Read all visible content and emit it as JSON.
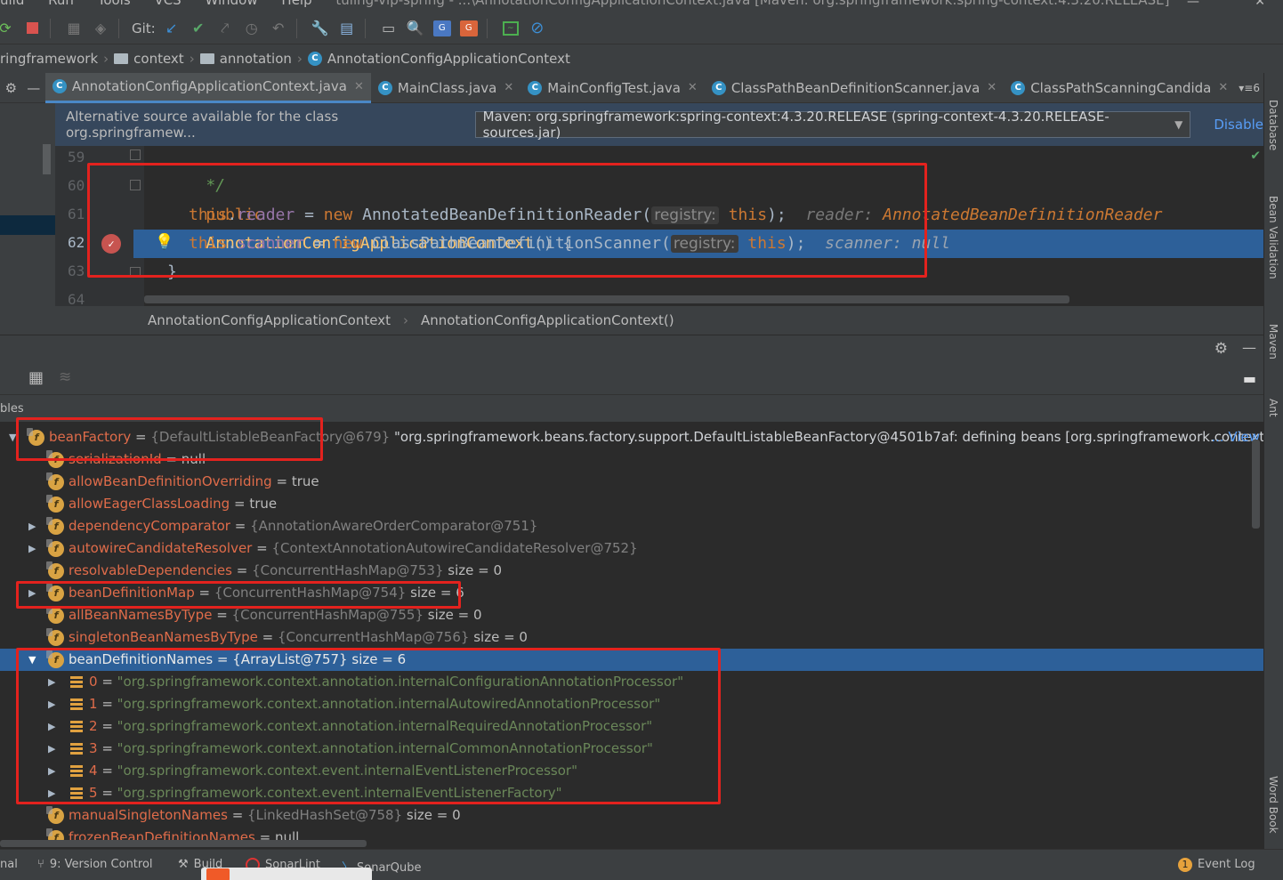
{
  "menu": {
    "items": [
      "uild",
      "Run",
      "Tools",
      "VCS",
      "Window",
      "Help"
    ],
    "window_title": "tuling-vip-spring - ...\\AnnotationConfigApplicationContext.java [Maven: org.springframework:spring-context:4.3.20.RELEASE]"
  },
  "toolbar": {
    "git_label": "Git:"
  },
  "breadcrumb": {
    "items": [
      "ringframework",
      "context",
      "annotation",
      "AnnotationConfigApplicationContext"
    ]
  },
  "tabs": [
    {
      "label": "AnnotationConfigApplicationContext.java",
      "active": true
    },
    {
      "label": "MainClass.java",
      "active": false
    },
    {
      "label": "MainConfigTest.java",
      "active": false
    },
    {
      "label": "ClassPathBeanDefinitionScanner.java",
      "active": false
    },
    {
      "label": "ClassPathScanningCandida",
      "active": false
    }
  ],
  "tabs_overflow": "▾≡6",
  "banner": {
    "message": "Alternative source available for the class org.springframew...",
    "selected_source": "Maven: org.springframework:spring-context:4.3.20.RELEASE (spring-context-4.3.20.RELEASE-sources.jar)",
    "disable_label": "Disable"
  },
  "editor": {
    "line_numbers": [
      "59",
      "60",
      "61",
      "62",
      "63",
      "64"
    ],
    "comment": "*/",
    "line60": {
      "kw": "public",
      "method": "AnnotationConfigApplicationContext",
      "rest": "() {"
    },
    "line61": {
      "this": "this",
      "field": "reader",
      "eq": " = ",
      "new": "new",
      "type": " AnnotatedBeanDefinitionReader(",
      "hint": "registry:",
      "arg": "this",
      "end": ");",
      "inline_name": "reader:",
      "inline_value": "AnnotatedBeanDefinitionReader"
    },
    "line62": {
      "this": "this",
      "field": "scanner",
      "eq": " = ",
      "new": "new",
      "type": " ClassPathBeanDefinitionScanner(",
      "hint": "registry:",
      "arg": "this",
      "end": ");",
      "inline_name": "scanner:",
      "inline_value": "null"
    },
    "line63": "}"
  },
  "structure_crumbs": [
    "AnnotationConfigApplicationContext",
    "AnnotationConfigApplicationContext()"
  ],
  "variables_header": "bles",
  "variables": [
    {
      "name": "beanFactory",
      "type": "{DefaultListableBeanFactory@679}",
      "value": "\"org.springframework.beans.factory.support.DefaultListableBeanFactory@4501b7af: defining beans [org.springframework.context",
      "view": "... View"
    },
    {
      "name": "serializationId",
      "value": "null"
    },
    {
      "name": "allowBeanDefinitionOverriding",
      "value": "true"
    },
    {
      "name": "allowEagerClassLoading",
      "value": "true"
    },
    {
      "name": "dependencyComparator",
      "type": "{AnnotationAwareOrderComparator@751}"
    },
    {
      "name": "autowireCandidateResolver",
      "type": "{ContextAnnotationAutowireCandidateResolver@752}"
    },
    {
      "name": "resolvableDependencies",
      "type": "{ConcurrentHashMap@753}",
      "value": "size = 0"
    },
    {
      "name": "beanDefinitionMap",
      "type": "{ConcurrentHashMap@754}",
      "value": "size = 6"
    },
    {
      "name": "allBeanNamesByType",
      "type": "{ConcurrentHashMap@755}",
      "value": "size = 0"
    },
    {
      "name": "singletonBeanNamesByType",
      "type": "{ConcurrentHashMap@756}",
      "value": "size = 0"
    },
    {
      "name": "beanDefinitionNames",
      "type": "{ArrayList@757}",
      "value": "size = 6"
    },
    {
      "index": "0",
      "value": "\"org.springframework.context.annotation.internalConfigurationAnnotationProcessor\""
    },
    {
      "index": "1",
      "value": "\"org.springframework.context.annotation.internalAutowiredAnnotationProcessor\""
    },
    {
      "index": "2",
      "value": "\"org.springframework.context.annotation.internalRequiredAnnotationProcessor\""
    },
    {
      "index": "3",
      "value": "\"org.springframework.context.annotation.internalCommonAnnotationProcessor\""
    },
    {
      "index": "4",
      "value": "\"org.springframework.context.event.internalEventListenerProcessor\""
    },
    {
      "index": "5",
      "value": "\"org.springframework.context.event.internalEventListenerFactory\""
    },
    {
      "name": "manualSingletonNames",
      "type": "{LinkedHashSet@758}",
      "value": "size = 0"
    },
    {
      "name": "frozenBeanDefinitionNames",
      "value": "null"
    }
  ],
  "right_tools": [
    "Database",
    "Bean Validation",
    "Maven",
    "Ant",
    "Word Book"
  ],
  "statusbar": {
    "left_cut": "nal",
    "version_control": "9: Version Control",
    "build": "Build",
    "sonarlint": "SonarLint",
    "sonarqube": "SonarQube",
    "event_count": "1",
    "event_log": "Event Log"
  },
  "colors": {
    "selection": "#2d6099",
    "annotation": "#e3221e",
    "link": "#589df6"
  }
}
